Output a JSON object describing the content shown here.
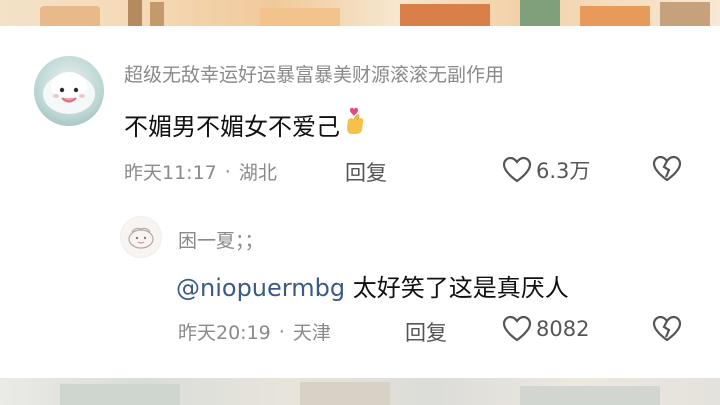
{
  "comment": {
    "username": "超级无敌幸运好运暴富暴美财源滚滚无副作用",
    "text": "不媚男不媚女不爱己",
    "emoji_name": "finger-heart-emoji",
    "time": "昨天11:17",
    "location": "湖北",
    "separator": "·",
    "reply_label": "回复",
    "likes": "6.3万"
  },
  "reply": {
    "username": "困一夏；；",
    "mention": "@niopuermbg",
    "text": " 太好笑了这是真厌人",
    "time": "昨天20:19",
    "location": "天津",
    "separator": "·",
    "reply_label": "回复",
    "likes": "8082"
  },
  "colors": {
    "text_primary": "#111111",
    "text_secondary": "#8a8a8a",
    "mention": "#3b5a86",
    "action": "#555555"
  }
}
